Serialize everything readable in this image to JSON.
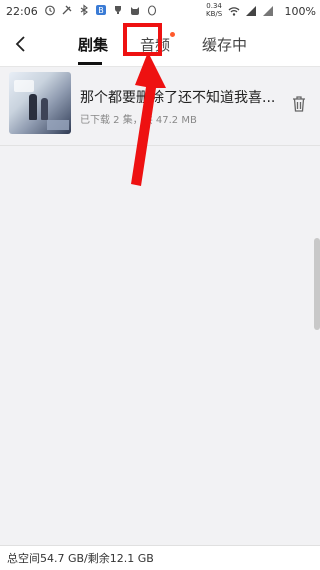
{
  "status_bar": {
    "time": "22:06",
    "net_speed_value": "0.34",
    "net_speed_unit": "KB/S",
    "battery": "100%"
  },
  "header": {
    "tabs": [
      {
        "label": "剧集",
        "active": true
      },
      {
        "label": "音频",
        "active": false,
        "has_badge": true
      },
      {
        "label": "缓存中",
        "active": false
      }
    ]
  },
  "downloads": [
    {
      "title": "那个都要删除了还不知道我喜...",
      "meta": "已下载 2 集，共 47.2 MB"
    }
  ],
  "footer": {
    "storage_text": "总空间54.7 GB/剩余12.1 GB"
  },
  "colors": {
    "annotation": "#ee1111",
    "badge_dot": "#ff5a2c"
  }
}
